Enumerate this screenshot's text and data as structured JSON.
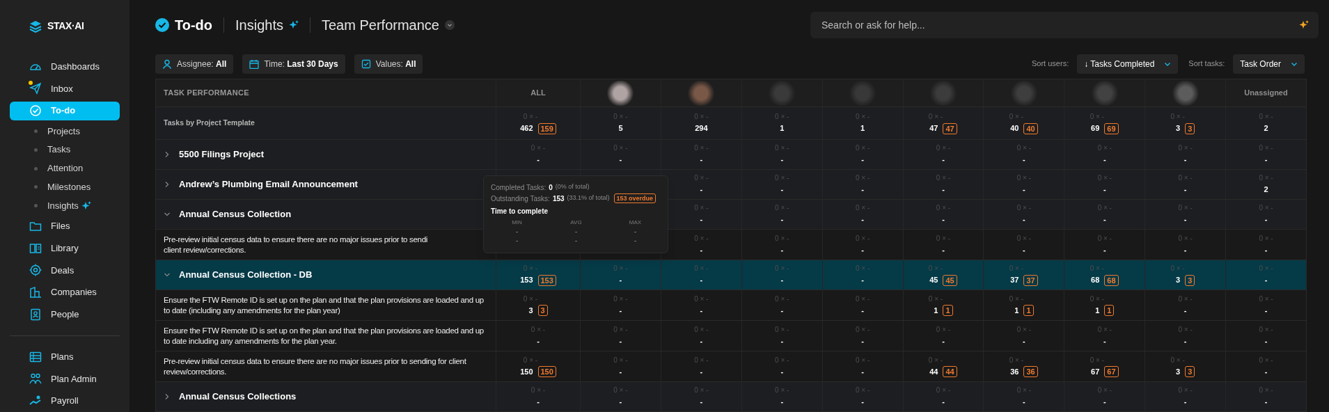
{
  "brand": {
    "name": "STAX·AI"
  },
  "sidebar": {
    "items": [
      {
        "kind": "nav",
        "label": "Dashboards",
        "selected": false,
        "unread": false
      },
      {
        "kind": "nav",
        "label": "Inbox",
        "selected": false,
        "unread": true
      },
      {
        "kind": "nav",
        "label": "To-do",
        "selected": true,
        "unread": false
      },
      {
        "kind": "sub",
        "label": "Projects",
        "selected": false
      },
      {
        "kind": "sub",
        "label": "Tasks",
        "selected": false
      },
      {
        "kind": "sub",
        "label": "Attention",
        "selected": false
      },
      {
        "kind": "sub",
        "label": "Milestones",
        "selected": false
      },
      {
        "kind": "sub",
        "label": "Insights",
        "selected": false,
        "ai": true
      },
      {
        "kind": "nav",
        "label": "Files",
        "selected": false,
        "unread": false
      },
      {
        "kind": "nav",
        "label": "Library",
        "selected": false,
        "unread": false
      },
      {
        "kind": "nav",
        "label": "Deals",
        "selected": false,
        "unread": false
      },
      {
        "kind": "nav",
        "label": "Companies",
        "selected": false,
        "unread": false
      },
      {
        "kind": "nav",
        "label": "People",
        "selected": false,
        "unread": false
      },
      {
        "kind": "divider"
      },
      {
        "kind": "nav",
        "label": "Plans",
        "selected": false,
        "unread": false
      },
      {
        "kind": "nav",
        "label": "Plan Admin",
        "selected": false,
        "unread": false
      },
      {
        "kind": "nav",
        "label": "Payroll",
        "selected": false,
        "unread": false
      }
    ]
  },
  "breadcrumb": [
    {
      "label": "To-do"
    },
    {
      "label": "Insights",
      "ai": true
    },
    {
      "label": "Team Performance",
      "dropdown": true
    }
  ],
  "search": {
    "placeholder": "Search or ask for help..."
  },
  "filters": [
    {
      "label": "Assignee:",
      "value": "All"
    },
    {
      "label": "Time:",
      "value": "Last 30 Days"
    },
    {
      "label": "Values:",
      "value": "All"
    }
  ],
  "sorts": [
    {
      "label": "Sort users:",
      "value": "↓ Tasks Completed"
    },
    {
      "label": "Sort tasks:",
      "value": "Task Order"
    }
  ],
  "table": {
    "title": "TASK PERFORMANCE",
    "columns": [
      {
        "kind": "text",
        "label": "ALL"
      },
      {
        "kind": "avatar"
      },
      {
        "kind": "avatar"
      },
      {
        "kind": "avatar"
      },
      {
        "kind": "avatar"
      },
      {
        "kind": "avatar"
      },
      {
        "kind": "avatar"
      },
      {
        "kind": "avatar"
      },
      {
        "kind": "avatar"
      },
      {
        "kind": "text",
        "label": "Unassigned"
      }
    ],
    "rows": [
      {
        "kind": "summary",
        "label": "Tasks by Project Template",
        "selected": false,
        "cells": [
          {
            "stat": "0 × -",
            "total": "462",
            "overdue": "159"
          },
          {
            "stat": "0 × -",
            "total": "5"
          },
          {
            "stat": "0 × -",
            "total": "294"
          },
          {
            "stat": "0 × -",
            "total": "1"
          },
          {
            "stat": "0 × -",
            "total": "1"
          },
          {
            "stat": "0 × -",
            "total": "47",
            "overdue": "47"
          },
          {
            "stat": "0 × -",
            "total": "40",
            "overdue": "40"
          },
          {
            "stat": "0 × -",
            "total": "69",
            "overdue": "69"
          },
          {
            "stat": "0 × -",
            "total": "3",
            "overdue": "3"
          },
          {
            "stat": "0 × -",
            "total": "2"
          }
        ]
      },
      {
        "kind": "group",
        "label": "5500 Filings Project",
        "expanded": false,
        "selected": false,
        "cells": [
          {
            "stat": "0 × -",
            "total": "-"
          },
          {
            "stat": "0 × -",
            "total": "-"
          },
          {
            "stat": "0 × -",
            "total": "-"
          },
          {
            "stat": "0 × -",
            "total": "-"
          },
          {
            "stat": "0 × -",
            "total": "-"
          },
          {
            "stat": "0 × -",
            "total": "-"
          },
          {
            "stat": "0 × -",
            "total": "-"
          },
          {
            "stat": "0 × -",
            "total": "-"
          },
          {
            "stat": "0 × -",
            "total": "-"
          },
          {
            "stat": "0 × -",
            "total": "-"
          }
        ]
      },
      {
        "kind": "group",
        "label": "Andrew’s Plumbing Email Announcement",
        "expanded": false,
        "selected": false,
        "cells": [
          null,
          null,
          {
            "stat": "0 × -",
            "total": "-"
          },
          {
            "stat": "0 × -",
            "total": "-"
          },
          {
            "stat": "0 × -",
            "total": "-"
          },
          {
            "stat": "0 × -",
            "total": "-"
          },
          {
            "stat": "0 × -",
            "total": "-"
          },
          {
            "stat": "0 × -",
            "total": "-"
          },
          {
            "stat": "0 × -",
            "total": "-"
          },
          {
            "stat": "0 × -",
            "total": "2"
          }
        ]
      },
      {
        "kind": "group",
        "label": "Annual Census Collection",
        "expanded": true,
        "selected": false,
        "cells": [
          null,
          null,
          {
            "stat": "0 × -",
            "total": "-"
          },
          {
            "stat": "0 × -",
            "total": "-"
          },
          {
            "stat": "0 × -",
            "total": "-"
          },
          {
            "stat": "0 × -",
            "total": "-"
          },
          {
            "stat": "0 × -",
            "total": "-"
          },
          {
            "stat": "0 × -",
            "total": "-"
          },
          {
            "stat": "0 × -",
            "total": "-"
          },
          {
            "stat": "0 × -",
            "total": "-"
          }
        ]
      },
      {
        "kind": "task",
        "label": "Pre-review initial census data to ensure there are no major issues prior to sendi\nclient review/corrections.",
        "selected": false,
        "cells": [
          null,
          null,
          {
            "stat": "0 × -",
            "total": "-"
          },
          {
            "stat": "0 × -",
            "total": "-"
          },
          {
            "stat": "0 × -",
            "total": "-"
          },
          {
            "stat": "0 × -",
            "total": "-"
          },
          {
            "stat": "0 × -",
            "total": "-"
          },
          {
            "stat": "0 × -",
            "total": "-"
          },
          {
            "stat": "0 × -",
            "total": "-"
          },
          {
            "stat": "0 × -",
            "total": "-"
          }
        ]
      },
      {
        "kind": "group",
        "label": "Annual Census Collection - DB",
        "expanded": true,
        "selected": true,
        "cells": [
          {
            "stat": "0 × -",
            "total": "153",
            "overdue": "153"
          },
          {
            "stat": "0 × -",
            "total": "-"
          },
          {
            "stat": "0 × -",
            "total": "-"
          },
          {
            "stat": "0 × -",
            "total": "-"
          },
          {
            "stat": "0 × -",
            "total": "-"
          },
          {
            "stat": "0 × -",
            "total": "45",
            "overdue": "45"
          },
          {
            "stat": "0 × -",
            "total": "37",
            "overdue": "37"
          },
          {
            "stat": "0 × -",
            "total": "68",
            "overdue": "68"
          },
          {
            "stat": "0 × -",
            "total": "3",
            "overdue": "3"
          },
          {
            "stat": "0 × -",
            "total": "-"
          }
        ]
      },
      {
        "kind": "task",
        "label": "Ensure the FTW Remote ID is set up on the plan and that the plan provisions are loaded and up to date (including any amendments for the plan year)",
        "selected": false,
        "cells": [
          {
            "stat": "0 × -",
            "total": "3",
            "overdue": "3"
          },
          {
            "stat": "0 × -",
            "total": "-"
          },
          {
            "stat": "0 × -",
            "total": "-"
          },
          {
            "stat": "0 × -",
            "total": "-"
          },
          {
            "stat": "0 × -",
            "total": "-"
          },
          {
            "stat": "0 × -",
            "total": "1",
            "overdue": "1"
          },
          {
            "stat": "0 × -",
            "total": "1",
            "overdue": "1"
          },
          {
            "stat": "0 × -",
            "total": "1",
            "overdue": "1"
          },
          {
            "stat": "0 × -",
            "total": "-"
          },
          {
            "stat": "0 × -",
            "total": "-"
          }
        ]
      },
      {
        "kind": "task",
        "label": "Ensure the FTW Remote ID is set up on the plan and that the plan provisions are loaded and up to date including any amendments for the plan year.",
        "selected": false,
        "cells": [
          {
            "stat": "0 × -",
            "total": "-"
          },
          {
            "stat": "0 × -",
            "total": "-"
          },
          {
            "stat": "0 × -",
            "total": "-"
          },
          {
            "stat": "0 × -",
            "total": "-"
          },
          {
            "stat": "0 × -",
            "total": "-"
          },
          {
            "stat": "0 × -",
            "total": "-"
          },
          {
            "stat": "0 × -",
            "total": "-"
          },
          {
            "stat": "0 × -",
            "total": "-"
          },
          {
            "stat": "0 × -",
            "total": "-"
          },
          {
            "stat": "0 × -",
            "total": "-"
          }
        ]
      },
      {
        "kind": "task",
        "label": "Pre-review initial census data to ensure there are no major issues prior to sending for client review/corrections.",
        "selected": false,
        "cells": [
          {
            "stat": "0 × -",
            "total": "150",
            "overdue": "150"
          },
          {
            "stat": "0 × -",
            "total": "-"
          },
          {
            "stat": "0 × -",
            "total": "-"
          },
          {
            "stat": "0 × -",
            "total": "-"
          },
          {
            "stat": "0 × -",
            "total": "-"
          },
          {
            "stat": "0 × -",
            "total": "44",
            "overdue": "44"
          },
          {
            "stat": "0 × -",
            "total": "36",
            "overdue": "36"
          },
          {
            "stat": "0 × -",
            "total": "67",
            "overdue": "67"
          },
          {
            "stat": "0 × -",
            "total": "3",
            "overdue": "3"
          },
          {
            "stat": "0 × -",
            "total": "-"
          }
        ]
      },
      {
        "kind": "group",
        "label": "Annual Census Collections",
        "expanded": false,
        "selected": false,
        "cells": [
          {
            "stat": "0 × -",
            "total": "-"
          },
          {
            "stat": "0 × -",
            "total": "-"
          },
          {
            "stat": "0 × -",
            "total": "-"
          },
          {
            "stat": "0 × -",
            "total": "-"
          },
          {
            "stat": "0 × -",
            "total": "-"
          },
          {
            "stat": "0 × -",
            "total": "-"
          },
          {
            "stat": "0 × -",
            "total": "-"
          },
          {
            "stat": "0 × -",
            "total": "-"
          },
          {
            "stat": "0 × -",
            "total": "-"
          },
          {
            "stat": "0 × -",
            "total": "-"
          }
        ]
      }
    ]
  },
  "tooltip": {
    "lines": [
      {
        "label": "Completed Tasks:",
        "value": "0",
        "share": "(0% of total)"
      },
      {
        "label": "Outstanding Tasks:",
        "value": "153",
        "share": "(33.1% of total)",
        "badge": "153 overdue"
      }
    ],
    "heading": "Time to complete",
    "columns": [
      "MIN",
      "AVG",
      "MAX"
    ],
    "rows": [
      [
        "-",
        "-",
        "-"
      ],
      [
        "-",
        "-",
        "-"
      ]
    ]
  }
}
